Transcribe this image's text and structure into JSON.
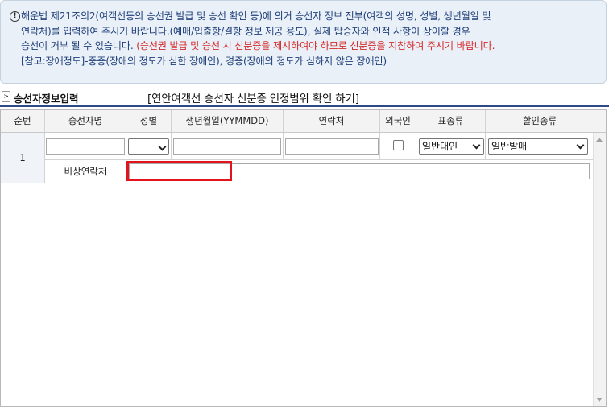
{
  "notice": {
    "line1": "해운법 제21조의2(여객선등의 승선권 발급 및 승선 확인 등)에 의거 승선자 정보 전부(여객의 성명, 성별, 생년월일 및",
    "line2": "연락처)를 입력하여 주시기 바랍니다.(예매/입출항/결항 정보 제공 용도), 실제 탑승자와 인적 사항이 상이할 경우",
    "line3_black": "승선이 거부 될 수 있습니다. ",
    "line3_red": "(승선권 발급 및 승선 시 신분증을 제시하여야 하므로 신분증을 지참하여 주시기 바랍니다.",
    "line4": "[참고:장애정도]-중증(장애의 정도가 심한 장애인), 경증(장애의 정도가 심하지 않은 장애인)"
  },
  "section": {
    "arrow": ">",
    "title": "승선자정보입력",
    "link": "[연안여객선 승선자 신분증 인정범위 확인 하기]"
  },
  "columns": [
    "순번",
    "승선자명",
    "성별",
    "생년월일(YYMMDD)",
    "연락처",
    "외국인",
    "표종류",
    "할인종류"
  ],
  "rows": [
    {
      "seq": "1",
      "name_value": "",
      "gender_value": "",
      "birth_value": "",
      "phone_value": "",
      "foreigner_checked": false,
      "ticket_type": "일반대인",
      "discount_type": "일반발매",
      "emergency_label": "비상연락처",
      "emergency_value": ""
    }
  ],
  "colors": {
    "notice_bg": "#eaf0f7",
    "notice_text": "#1f3f7a",
    "warning": "#d42a2a",
    "highlight": "#e3131e"
  }
}
